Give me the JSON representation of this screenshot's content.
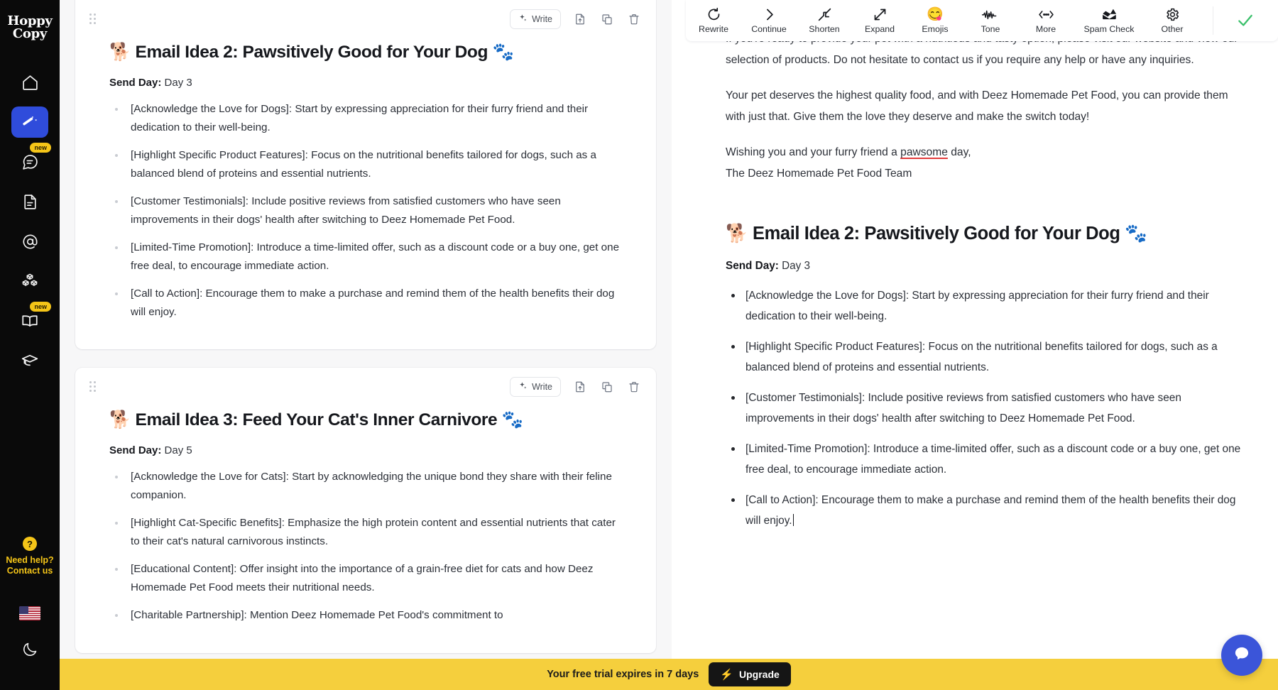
{
  "brand": {
    "line1": "Hoppy",
    "line2": "Copy"
  },
  "sidebar": {
    "items": [
      {
        "name": "home",
        "icon": "home-icon",
        "badge": ""
      },
      {
        "name": "campaigns",
        "icon": "magic-wand-icon",
        "badge": "",
        "active": true
      },
      {
        "name": "chat",
        "icon": "chat-bubble-icon",
        "badge": "new"
      },
      {
        "name": "documents",
        "icon": "document-icon",
        "badge": ""
      },
      {
        "name": "mentions",
        "icon": "at-sign-icon",
        "badge": ""
      },
      {
        "name": "templates",
        "icon": "blocks-icon",
        "badge": ""
      },
      {
        "name": "library",
        "icon": "open-book-icon",
        "badge": "new"
      },
      {
        "name": "academy",
        "icon": "graduation-cap-icon",
        "badge": ""
      }
    ],
    "help": {
      "line1": "Need help?",
      "line2": "Contact us",
      "icon": "question-mark-icon"
    },
    "language": "us-flag-icon",
    "theme_toggle": "moon-icon"
  },
  "editor": {
    "cards": [
      {
        "write_label": "Write",
        "actions": [
          "export-document-icon",
          "duplicate-icon",
          "trash-icon"
        ],
        "heading": "🐕 Email Idea 2: Pawsitively Good for Your Dog 🐾",
        "heading_emoji_left": "🐕",
        "heading_text": "Email Idea 2: Pawsitively Good for Your Dog",
        "heading_emoji_right": "🐾",
        "send_day_label": "Send Day:",
        "send_day_value": "Day 3",
        "bullets": [
          "[Acknowledge the Love for Dogs]: Start by expressing appreciation for their furry friend and their dedication to their well-being.",
          "[Highlight Specific Product Features]: Focus on the nutritional benefits tailored for dogs, such as a balanced blend of proteins and essential nutrients.",
          "[Customer Testimonials]: Include positive reviews from satisfied customers who have seen improvements in their dogs' health after switching to Deez Homemade Pet Food.",
          "[Limited-Time Promotion]: Introduce a time-limited offer, such as a discount code or a buy one, get one free deal, to encourage immediate action.",
          "[Call to Action]: Encourage them to make a purchase and remind them of the health benefits their dog will enjoy."
        ]
      },
      {
        "write_label": "Write",
        "actions": [
          "export-document-icon",
          "duplicate-icon",
          "trash-icon"
        ],
        "heading_emoji_left": "🐕",
        "heading_text": "Email Idea 3: Feed Your Cat's Inner Carnivore",
        "heading_emoji_right": "🐾",
        "send_day_label": "Send Day:",
        "send_day_value": "Day 5",
        "bullets": [
          "[Acknowledge the Love for Cats]: Start by acknowledging the unique bond they share with their feline companion.",
          "[Highlight Cat-Specific Benefits]: Emphasize the high protein content and essential nutrients that cater to their cat's natural carnivorous instincts.",
          "[Educational Content]: Offer insight into the importance of a grain-free diet for cats and how Deez Homemade Pet Food meets their nutritional needs.",
          "[Charitable Partnership]: Mention Deez Homemade Pet Food's commitment to"
        ]
      }
    ]
  },
  "toolbar": {
    "tools": [
      {
        "label": "Rewrite",
        "icon": "rotate-refresh-icon"
      },
      {
        "label": "Continue",
        "icon": "chevron-right-icon"
      },
      {
        "label": "Shorten",
        "icon": "arrows-collapse-icon"
      },
      {
        "label": "Expand",
        "icon": "arrows-expand-icon"
      },
      {
        "label": "Emojis",
        "icon": "smiley-emoji-icon"
      },
      {
        "label": "Tone",
        "icon": "waveform-icon"
      },
      {
        "label": "More",
        "icon": "ellipsis-chevrons-icon"
      },
      {
        "label": "Spam Check",
        "icon": "spam-inbox-warning-icon"
      },
      {
        "label": "Other",
        "icon": "gear-icon"
      }
    ],
    "status_icon": "green-check-icon",
    "status_color": "#39c06a"
  },
  "preview": {
    "paragraphs": [
      "If you're ready to provide your pet with a nutritious and tasty option, please visit our website and view our selection of products. Do not hesitate to contact us if you require any help or have any inquiries.",
      "Your pet deserves the highest quality food, and with Deez Homemade Pet Food, you can provide them with just that. Give them the love they deserve and make the switch today!"
    ],
    "signoff_prefix": "Wishing you and your furry friend a ",
    "signoff_misspelled": "pawsome",
    "signoff_suffix": " day,",
    "signoff_team": "The Deez Homemade Pet Food Team",
    "heading_emoji_left": "🐕",
    "heading_text": "Email Idea 2: Pawsitively Good for Your Dog",
    "heading_emoji_right": "🐾",
    "send_day_label": "Send Day:",
    "send_day_value": "Day 3",
    "bullets": [
      "[Acknowledge the Love for Dogs]: Start by expressing appreciation for their furry friend and their dedication to their well-being.",
      "[Highlight Specific Product Features]: Focus on the nutritional benefits tailored for dogs, such as a balanced blend of proteins and essential nutrients.",
      "[Customer Testimonials]: Include positive reviews from satisfied customers who have seen improvements in their dogs' health after switching to Deez Homemade Pet Food.",
      "[Limited-Time Promotion]: Introduce a time-limited offer, such as a discount code or a buy one, get one free deal, to encourage immediate action.",
      "[Call to Action]: Encourage them to make a purchase and remind them of the health benefits their dog will enjoy."
    ]
  },
  "trial_banner": {
    "text": "Your free trial expires in 7 days",
    "button_label": "Upgrade",
    "button_icon": "lightning-bolt-icon",
    "background": "#f5cf3d"
  },
  "chat_widget": {
    "icon": "chat-bubble-icon",
    "color": "#3b55d9"
  }
}
